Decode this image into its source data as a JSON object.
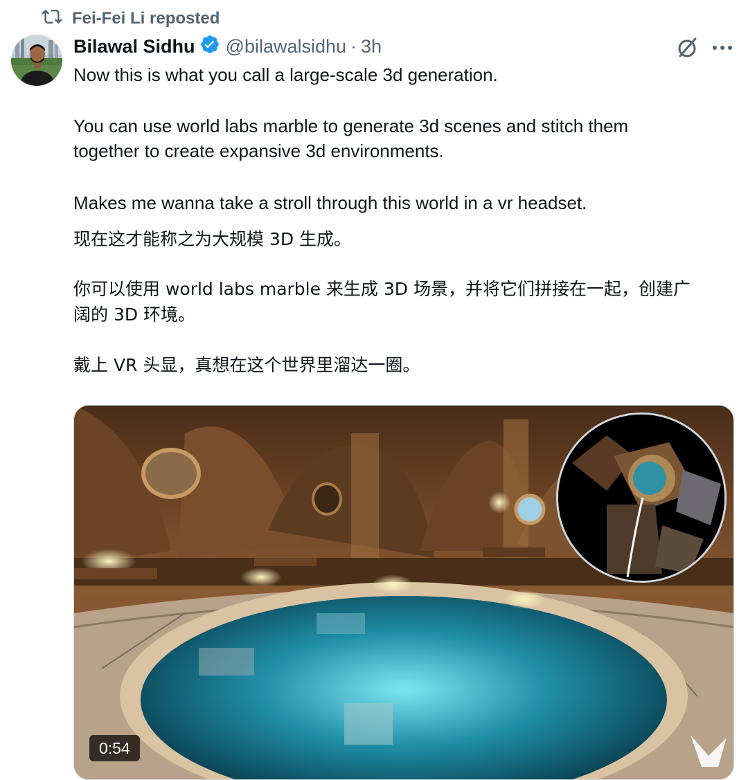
{
  "repost": {
    "label": "Fei-Fei Li reposted",
    "icon": "repost-icon"
  },
  "author": {
    "name": "Bilawal Sidhu",
    "handle": "@bilawalsidhu",
    "separator": "·",
    "time": "3h",
    "verified_icon": "verified-badge-icon",
    "verified_color": "#1d9bf0"
  },
  "actions": {
    "grok_icon": "grok-icon",
    "more_icon": "more-icon"
  },
  "post": {
    "en_line1": "Now this is what you call a large-scale 3d generation.",
    "en_line2": "You can use world labs marble to generate 3d scenes and stitch them",
    "en_line3": "together to create expansive 3d environments.",
    "en_line4": "Makes me wanna take a stroll through this world in a vr headset.",
    "zh_line1": "现在这才能称之为大规模 3D 生成。",
    "zh_line2": "你可以使用 world labs marble 来生成 3D 场景，并将它们拼接在一起，创建广",
    "zh_line3": "阔的 3D 环境。",
    "zh_line4": "戴上 VR 头显，真想在这个世界里溜达一圈。"
  },
  "media": {
    "duration": "0:54",
    "scene": "3d-generated-hobbit-style-room-with-glowing-pool",
    "minimap": "overhead-map-of-stitched-3d-scenes",
    "watermark_icon": "marble-logo-icon"
  }
}
